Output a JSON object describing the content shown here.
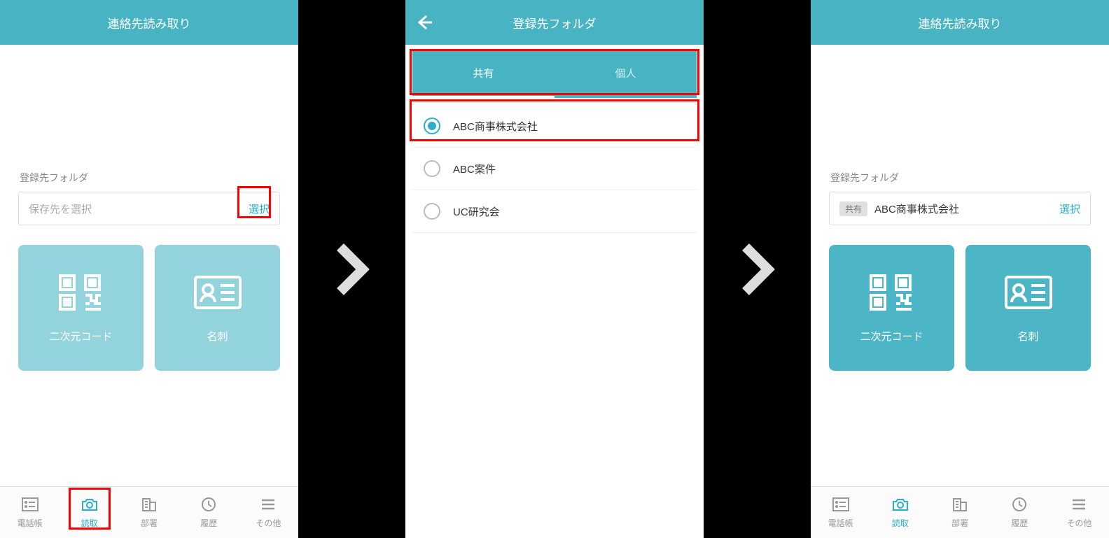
{
  "screens": {
    "scan": {
      "title": "連絡先読み取り",
      "folder_label": "登録先フォルダ",
      "placeholder": "保存先を選択",
      "select_btn": "選択",
      "tiles": {
        "qr": "二次元コード",
        "card": "名刺"
      }
    },
    "folders": {
      "title": "登録先フォルダ",
      "tabs": {
        "shared": "共有",
        "personal": "個人"
      },
      "items": [
        {
          "label": "ABC商事株式会社",
          "checked": true
        },
        {
          "label": "ABC案件",
          "checked": false
        },
        {
          "label": "UC研究会",
          "checked": false
        }
      ]
    },
    "result": {
      "title": "連絡先読み取り",
      "folder_label": "登録先フォルダ",
      "badge": "共有",
      "value": "ABC商事株式会社",
      "select_btn": "選択",
      "tiles": {
        "qr": "二次元コード",
        "card": "名刺"
      }
    }
  },
  "nav": {
    "items": [
      {
        "label": "電話帳"
      },
      {
        "label": "読取"
      },
      {
        "label": "部署"
      },
      {
        "label": "履歴"
      },
      {
        "label": "その他"
      }
    ]
  }
}
